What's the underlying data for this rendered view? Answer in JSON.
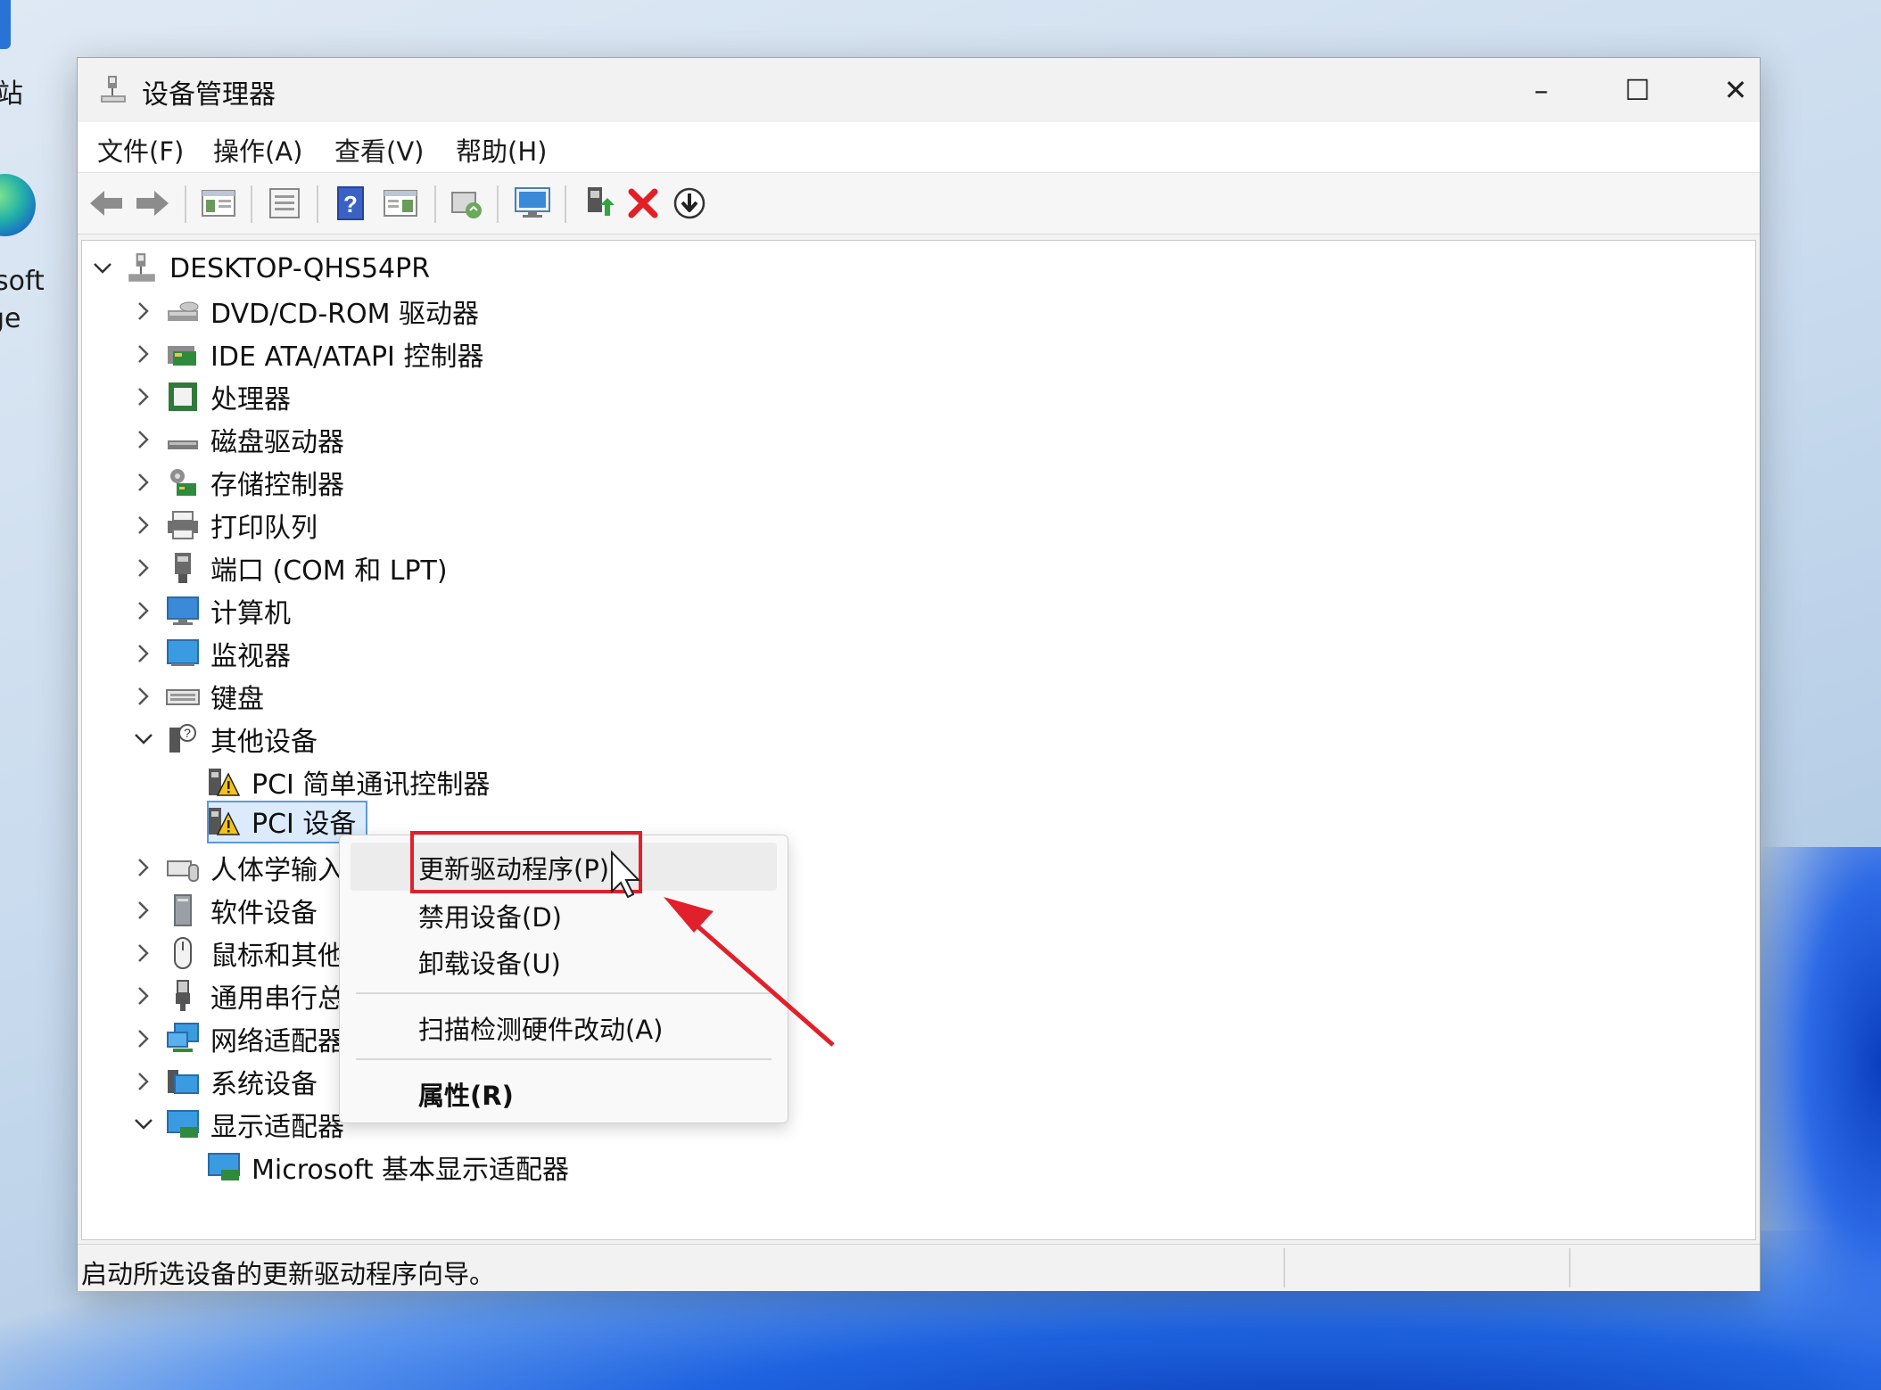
{
  "desktop": {
    "labels": [
      "站",
      "soft",
      "ge"
    ]
  },
  "window": {
    "title": "设备管理器",
    "controls": {
      "minimize": "–",
      "maximize": "☐",
      "close": "✕"
    }
  },
  "menubar": {
    "items": [
      "文件(F)",
      "操作(A)",
      "查看(V)",
      "帮助(H)"
    ]
  },
  "toolbar": {
    "buttons": [
      "back-icon",
      "forward-icon",
      "show-hide-tree-icon",
      "properties-icon",
      "help-icon",
      "view-icon",
      "scan-hardware-icon",
      "monitor-icon",
      "update-driver-icon",
      "uninstall-icon",
      "download-icon"
    ]
  },
  "tree": {
    "root": "DESKTOP-QHS54PR",
    "categories": [
      {
        "label": "DVD/CD-ROM 驱动器",
        "expanded": false
      },
      {
        "label": "IDE ATA/ATAPI 控制器",
        "expanded": false
      },
      {
        "label": "处理器",
        "expanded": false
      },
      {
        "label": "磁盘驱动器",
        "expanded": false
      },
      {
        "label": "存储控制器",
        "expanded": false
      },
      {
        "label": "打印队列",
        "expanded": false
      },
      {
        "label": "端口 (COM 和 LPT)",
        "expanded": false
      },
      {
        "label": "计算机",
        "expanded": false
      },
      {
        "label": "监视器",
        "expanded": false
      },
      {
        "label": "键盘",
        "expanded": false
      },
      {
        "label": "其他设备",
        "expanded": true
      },
      {
        "label": "PCI 简单通讯控制器",
        "child": true
      },
      {
        "label": "PCI 设备",
        "child": true,
        "selected": true
      },
      {
        "label": "人体学输入",
        "expanded": false
      },
      {
        "label": "软件设备",
        "expanded": false
      },
      {
        "label": "鼠标和其他",
        "expanded": false
      },
      {
        "label": "通用串行总",
        "expanded": false
      },
      {
        "label": "网络适配器",
        "expanded": false
      },
      {
        "label": "系统设备",
        "expanded": false
      },
      {
        "label": "显示适配器",
        "expanded": true
      },
      {
        "label": "Microsoft 基本显示适配器",
        "child": true
      }
    ]
  },
  "context_menu": {
    "items": [
      {
        "label": "更新驱动程序(P)",
        "hovered": true
      },
      {
        "label": "禁用设备(D)"
      },
      {
        "label": "卸载设备(U)"
      },
      {
        "label": "扫描检测硬件改动(A)"
      },
      {
        "label": "属性(R)",
        "bold": true
      }
    ]
  },
  "statusbar": {
    "text": "启动所选设备的更新驱动程序向导。"
  },
  "colors": {
    "annotation": "#e0202a",
    "selection": "#dcebfc",
    "warning": "#f4c21a"
  }
}
